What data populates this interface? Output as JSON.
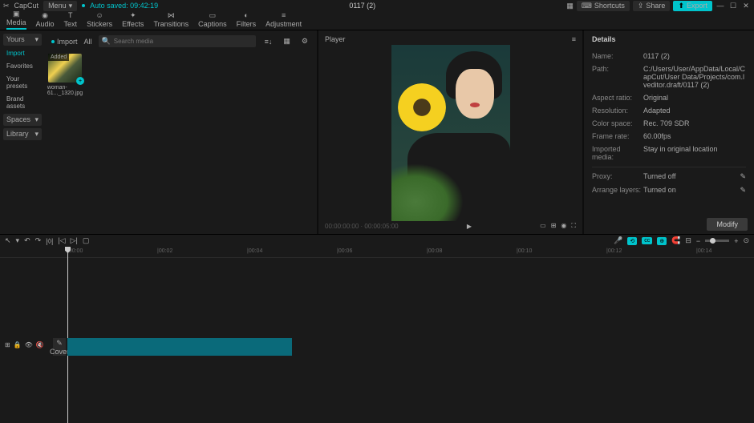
{
  "titlebar": {
    "app": "CapCut",
    "menu": "Menu",
    "autosave": "Auto saved: 09:42:19",
    "title": "0117 (2)",
    "shortcuts": "Shortcuts",
    "share": "Share",
    "export": "Export"
  },
  "tabs": [
    "Media",
    "Audio",
    "Text",
    "Stickers",
    "Effects",
    "Transitions",
    "Captions",
    "Filters",
    "Adjustment"
  ],
  "left": {
    "yours": "Yours",
    "import": "Import",
    "favorites": "Favorites",
    "presets": "Your presets",
    "brand": "Brand assets",
    "spaces": "Spaces",
    "library": "Library"
  },
  "media": {
    "import": "Import",
    "all": "All",
    "search": "Search media",
    "added": "Added",
    "filename": "woman-61..._1320.jpg"
  },
  "player": {
    "title": "Player"
  },
  "details": {
    "title": "Details",
    "rows": [
      {
        "k": "Name:",
        "v": "0117 (2)"
      },
      {
        "k": "Path:",
        "v": "C:/Users/User/AppData/Local/CapCut/User Data/Projects/com.lveditor.draft/0117  (2)"
      },
      {
        "k": "Aspect ratio:",
        "v": "Original"
      },
      {
        "k": "Resolution:",
        "v": "Adapted"
      },
      {
        "k": "Color space:",
        "v": "Rec. 709 SDR"
      },
      {
        "k": "Frame rate:",
        "v": "60.00fps"
      },
      {
        "k": "Imported media:",
        "v": "Stay in original location"
      }
    ],
    "rows2": [
      {
        "k": "Proxy:",
        "v": "Turned off"
      },
      {
        "k": "Arrange layers:",
        "v": "Turned on"
      }
    ],
    "modify": "Modify"
  },
  "ruler": [
    "|00:00",
    "|00:02",
    "|00:04",
    "|00:06",
    "|00:08",
    "|00:10",
    "|00:12",
    "|00:14"
  ],
  "cover": "Cover"
}
